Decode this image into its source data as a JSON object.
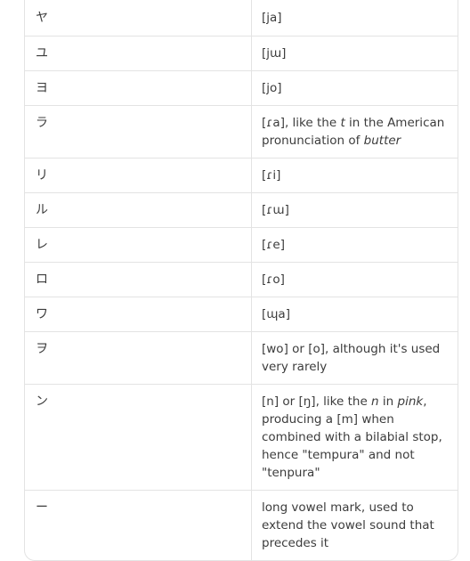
{
  "rows": [
    {
      "kana": "ヤ",
      "parts": [
        {
          "t": "[ja]"
        }
      ]
    },
    {
      "kana": "ユ",
      "parts": [
        {
          "t": "[jɯ]"
        }
      ]
    },
    {
      "kana": "ヨ",
      "parts": [
        {
          "t": "[jo]"
        }
      ]
    },
    {
      "kana": "ラ",
      "parts": [
        {
          "t": "[ɾa], like the "
        },
        {
          "t": "t",
          "i": true
        },
        {
          "t": " in the American pronunciation of "
        },
        {
          "t": "butter",
          "i": true
        }
      ]
    },
    {
      "kana": "リ",
      "parts": [
        {
          "t": "[ɾi]"
        }
      ]
    },
    {
      "kana": "ル",
      "parts": [
        {
          "t": "[ɾɯ]"
        }
      ]
    },
    {
      "kana": "レ",
      "parts": [
        {
          "t": "[ɾe]"
        }
      ]
    },
    {
      "kana": "ロ",
      "parts": [
        {
          "t": "[ɾo]"
        }
      ]
    },
    {
      "kana": "ワ",
      "parts": [
        {
          "t": "[ɰa]"
        }
      ]
    },
    {
      "kana": "ヲ",
      "parts": [
        {
          "t": "[wo] or [o], although it's used very rarely"
        }
      ]
    },
    {
      "kana": "ン",
      "parts": [
        {
          "t": "[n] or [ŋ], like the "
        },
        {
          "t": "n",
          "i": true
        },
        {
          "t": " in "
        },
        {
          "t": "pink",
          "i": true
        },
        {
          "t": ", producing a [m] when combined with a bilabial stop, hence \"tempura\" and not \"tenpura\""
        }
      ]
    },
    {
      "kana": "ー",
      "parts": [
        {
          "t": "long vowel mark, used to extend the vowel sound that precedes it"
        }
      ]
    }
  ]
}
